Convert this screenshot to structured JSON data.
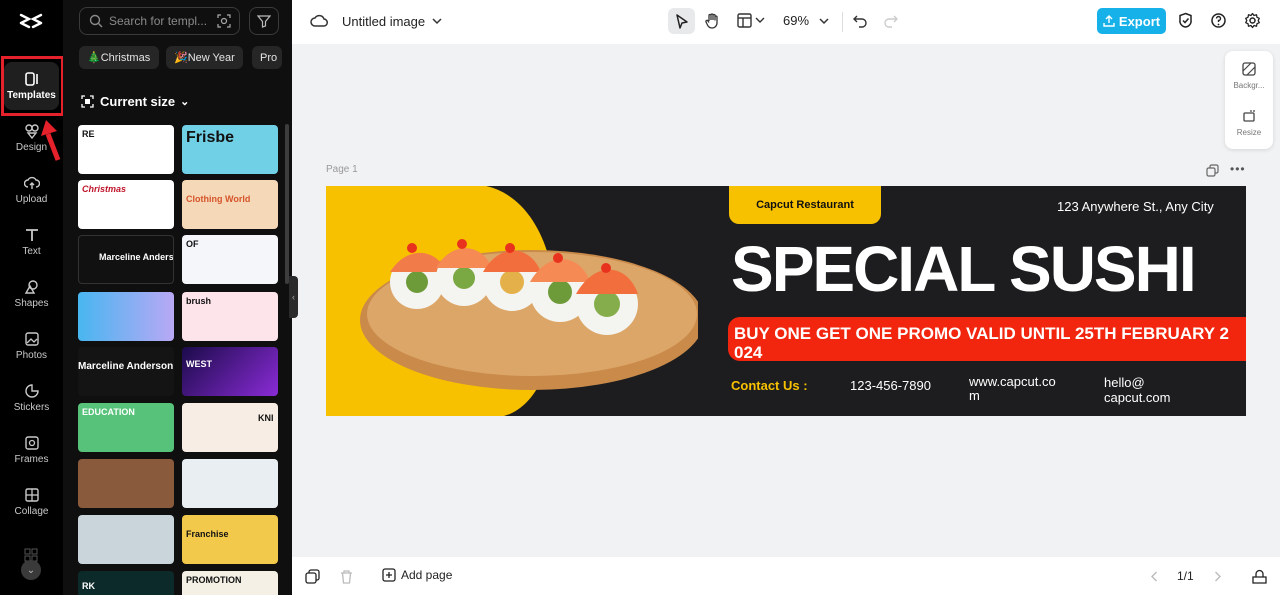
{
  "app": {
    "logo": "capcut-logo",
    "document_title": "Untitled image",
    "zoom": "69%",
    "export_label": "Export"
  },
  "rail": {
    "items": [
      {
        "label": "Templates",
        "icon": "templates-icon"
      },
      {
        "label": "Design",
        "icon": "design-icon"
      },
      {
        "label": "Upload",
        "icon": "upload-icon"
      },
      {
        "label": "Text",
        "icon": "text-icon"
      },
      {
        "label": "Shapes",
        "icon": "shapes-icon"
      },
      {
        "label": "Photos",
        "icon": "photos-icon"
      },
      {
        "label": "Stickers",
        "icon": "stickers-icon"
      },
      {
        "label": "Frames",
        "icon": "frames-icon"
      },
      {
        "label": "Collage",
        "icon": "collage-icon"
      }
    ],
    "active": "Templates",
    "highlight_color": "#e5212b"
  },
  "panel": {
    "search_placeholder": "Search for templ...",
    "chips": [
      "🎄Christmas",
      "🎉New Year",
      "Pro"
    ],
    "current_size_label": "Current size",
    "thumbnails": [
      {
        "text": "RE"
      },
      {
        "text": "Frisbe"
      },
      {
        "text": "Christmas"
      },
      {
        "text": "Clothing World"
      },
      {
        "text": "Marceline Anders"
      },
      {
        "text": "OF"
      },
      {
        "text": ""
      },
      {
        "text": "brush"
      },
      {
        "text": "Marceline Anderson"
      },
      {
        "text": "WEST"
      },
      {
        "text": "EDUCATION"
      },
      {
        "text": "KNI"
      },
      {
        "text": ""
      },
      {
        "text": ""
      },
      {
        "text": ""
      },
      {
        "text": "Franchise"
      },
      {
        "text": "RK"
      },
      {
        "text": "PROMOTION"
      }
    ]
  },
  "right_tools": [
    {
      "label": "Backgr...",
      "icon": "background-icon"
    },
    {
      "label": "Resize",
      "icon": "resize-icon"
    }
  ],
  "canvas": {
    "page_label": "Page 1",
    "design": {
      "brand": "Capcut Restaurant",
      "address": "123 Anywhere St., Any City",
      "headline": "SPECIAL SUSHI",
      "promo": "BUY ONE GET ONE PROMO VALID UNTIL 25TH FEBRUARY 2 024",
      "contact_label": "Contact Us :",
      "phone": "123-456-7890",
      "website": "www.capcut.co m",
      "email": "hello@ capcut.com",
      "colors": {
        "yellow": "#f7c100",
        "dark": "#1d1d1f",
        "red": "#f2260f"
      }
    }
  },
  "bottombar": {
    "add_page_label": "Add page",
    "page_count": "1/1"
  }
}
